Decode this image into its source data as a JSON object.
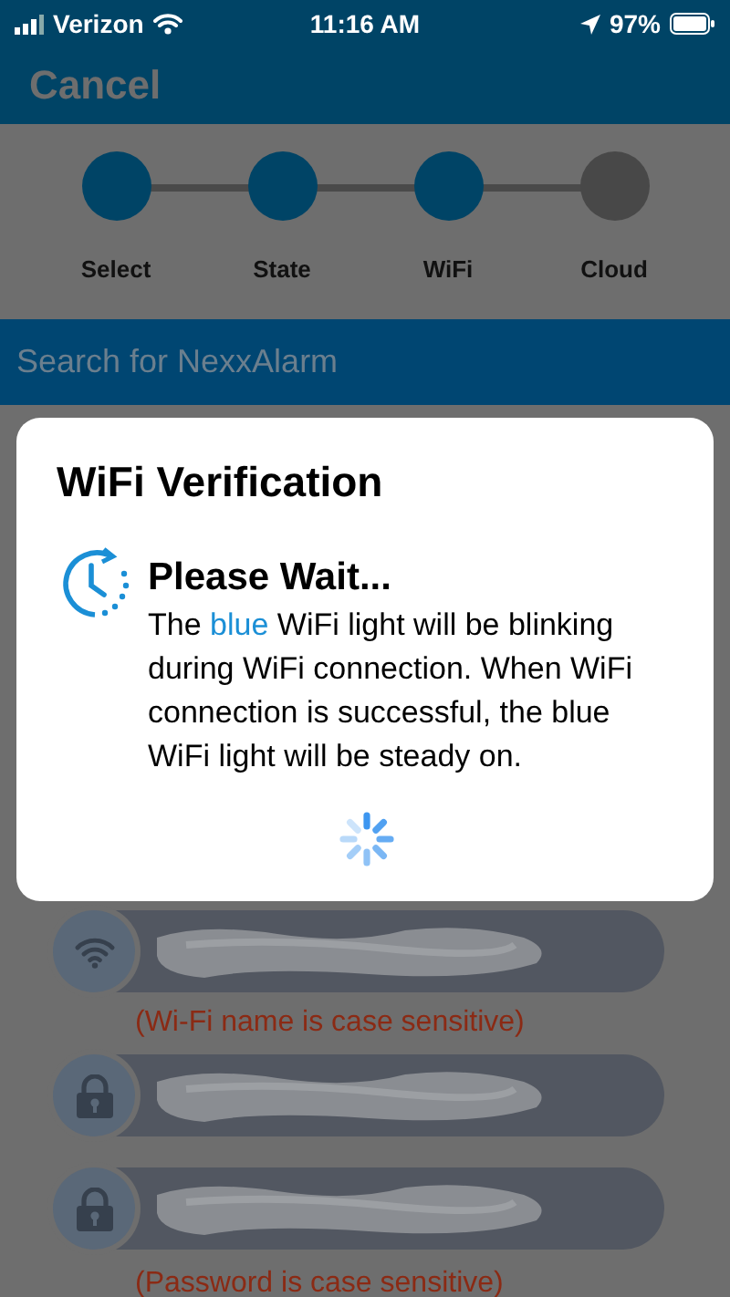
{
  "status_bar": {
    "carrier": "Verizon",
    "time": "11:16 AM",
    "battery": "97%"
  },
  "header": {
    "cancel": "Cancel"
  },
  "steps": [
    {
      "label": "Select",
      "completed": true
    },
    {
      "label": "State",
      "completed": true
    },
    {
      "label": "WiFi",
      "completed": true
    },
    {
      "label": "Cloud",
      "completed": false
    }
  ],
  "search": {
    "placeholder": "Search for NexxAlarm"
  },
  "dialog": {
    "title": "WiFi Verification",
    "heading": "Please Wait...",
    "message": "The *blue* WiFi light will be blinking during WiFi connection. When WiFi connection is successful, the blue WiFi light will be steady on.",
    "loading": true
  },
  "fields": [
    {
      "kind": "wifi",
      "redacted": true,
      "hint": "(Wi-Fi name is case sensitive)"
    },
    {
      "kind": "lock",
      "redacted": true
    },
    {
      "kind": "lock",
      "redacted": true,
      "hint": "(Password is case sensitive)"
    }
  ]
}
